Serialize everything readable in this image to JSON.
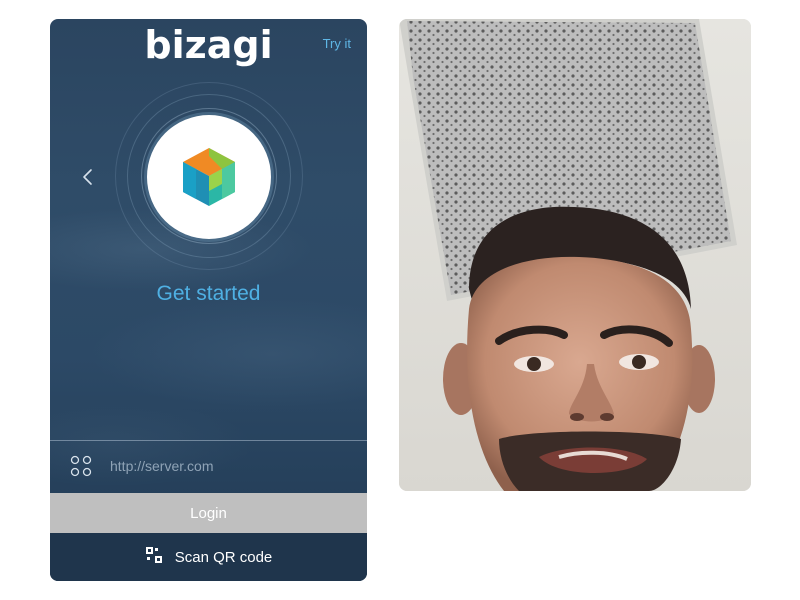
{
  "app": {
    "brand": "bizagi",
    "try_link": "Try it",
    "headline": "Get started",
    "server": {
      "value": "",
      "placeholder": "http://server.com"
    },
    "login_label": "Login",
    "scan_label": "Scan QR code",
    "accent_color": "#4fb0e3",
    "icons": [
      "chevron-left-icon",
      "bizagi-cube-logo",
      "server-grid-icon",
      "qr-code-icon"
    ]
  },
  "video": {
    "subject": "webcam-feed"
  }
}
